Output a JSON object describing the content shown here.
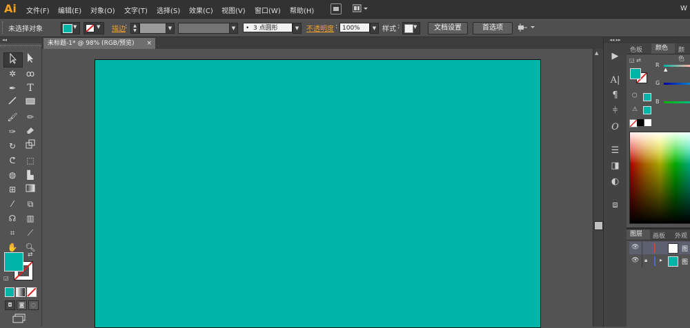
{
  "app": {
    "logo": "Ai",
    "accent_color": "#f0a020",
    "fill_color": "#00b4a7"
  },
  "menu": {
    "items": [
      "文件(F)",
      "编辑(E)",
      "对象(O)",
      "文字(T)",
      "选择(S)",
      "效果(C)",
      "视图(V)",
      "窗口(W)",
      "帮助(H)"
    ],
    "right_text": "W"
  },
  "control_bar": {
    "selection_label": "未选择对象",
    "stroke_label": "描边",
    "brush_value": "3 点圆形",
    "opacity_label": "不透明度",
    "opacity_value": "100%",
    "style_label": "样式",
    "doc_settings_button": "文档设置",
    "preferences_button": "首选项"
  },
  "document_tab": {
    "title": "未标题-1* @ 98% (RGB/预览)",
    "close": "×"
  },
  "color_panel": {
    "tabs": [
      "色板",
      "颜色",
      "颜色"
    ],
    "channels": [
      "R",
      "G",
      "B"
    ]
  },
  "layers_panel": {
    "tabs": [
      "图层",
      "画板",
      "外观"
    ],
    "rows": [
      {
        "label": "图",
        "color": "#e0403a"
      },
      {
        "label": "图",
        "color": "#4a6ad0"
      }
    ]
  }
}
